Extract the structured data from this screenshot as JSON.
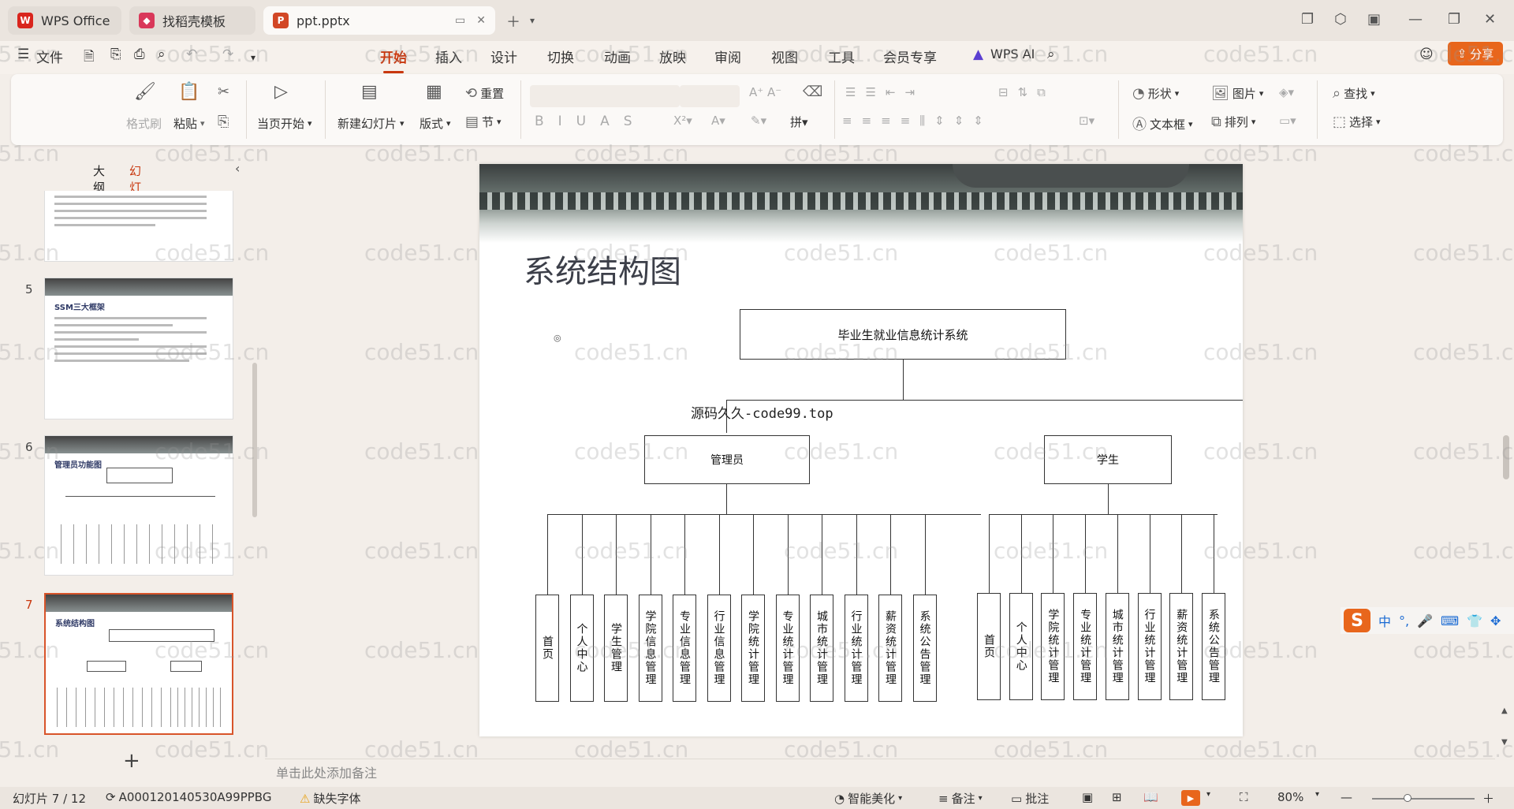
{
  "tabs": [
    {
      "label": "WPS Office",
      "icon": "wps-logo-icon",
      "color": "#d9251d"
    },
    {
      "label": "找稻壳模板",
      "icon": "daoke-icon",
      "color": "#d9385a"
    },
    {
      "label": "ppt.pptx",
      "icon": "ppt-file-icon",
      "color": "#d24726"
    }
  ],
  "menu": {
    "file": "文件",
    "items": [
      "开始",
      "插入",
      "设计",
      "切换",
      "动画",
      "放映",
      "审阅",
      "视图",
      "工具",
      "会员专享"
    ],
    "active": "开始",
    "wps_ai": "WPS AI",
    "share": "分享"
  },
  "ribbon": {
    "format_painter": "格式刷",
    "paste": "粘贴",
    "start_from_current": "当页开始",
    "new_slide": "新建幻灯片",
    "layout": "版式",
    "reset": "重置",
    "section": "节",
    "shape": "形状",
    "picture": "图片",
    "textbox": "文本框",
    "arrange": "排列",
    "find": "查找",
    "select": "选择"
  },
  "left_panel": {
    "tab_outline": "大纲",
    "tab_slides": "幻灯片",
    "slides": [
      {
        "number": "5",
        "title": "SSM三大框架"
      },
      {
        "number": "6",
        "title": "管理员功能图"
      },
      {
        "number": "7",
        "title": "系统结构图"
      }
    ]
  },
  "slide": {
    "title": "系统结构图",
    "bullet": "◎",
    "overlay_text": "源码久久-code99.top",
    "root": "毕业生就业信息统计系统",
    "admin": {
      "label": "管理员",
      "children": [
        "首页",
        "个人中心",
        "学生管理",
        "学院信息管理",
        "专业信息管理",
        "行业信息管理",
        "学院统计管理",
        "专业统计管理",
        "城市统计管理",
        "行业统计管理",
        "薪资统计管理",
        "系统公告管理"
      ]
    },
    "student": {
      "label": "学生",
      "children": [
        "首页",
        "个人中心",
        "学院统计管理",
        "专业统计管理",
        "城市统计管理",
        "行业统计管理",
        "薪资统计管理",
        "系统公告管理"
      ]
    }
  },
  "notes_placeholder": "单击此处添加备注",
  "status": {
    "slide_counter": "幻灯片 7 / 12",
    "doc_id": "A000120140530A99PPBG",
    "missing_font": "缺失字体",
    "smart_beautify": "智能美化",
    "notes": "备注",
    "comments": "批注",
    "zoom": "80%"
  },
  "ime": {
    "mode": "中",
    "logo": "S"
  },
  "watermark": "code51.cn"
}
